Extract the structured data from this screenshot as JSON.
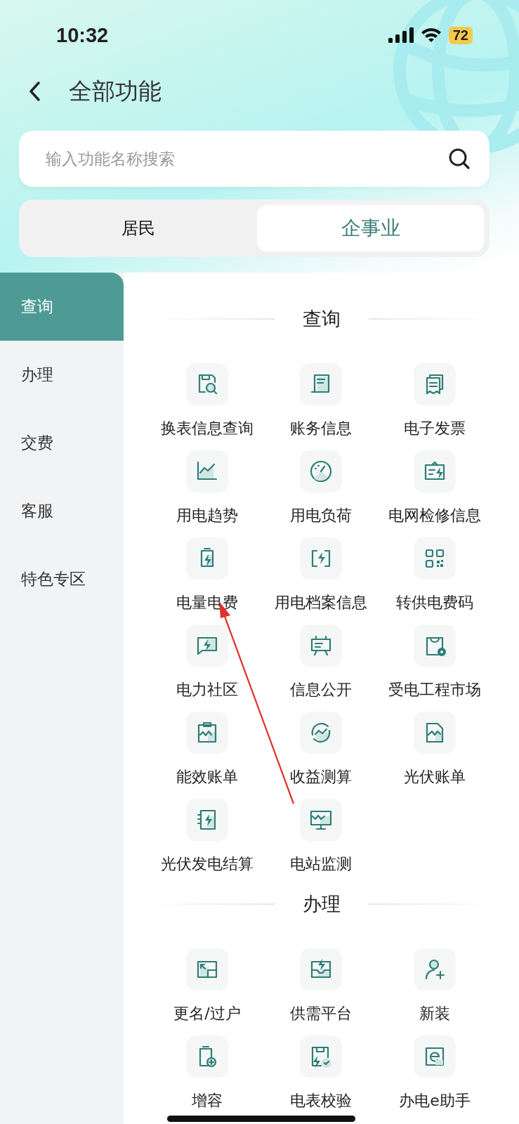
{
  "status_bar": {
    "time": "10:32",
    "battery": "72"
  },
  "header": {
    "title": "全部功能"
  },
  "search": {
    "placeholder": "输入功能名称搜索"
  },
  "tabs": [
    {
      "label": "居民",
      "selected": false
    },
    {
      "label": "企事业",
      "selected": true
    }
  ],
  "sidebar": {
    "items": [
      {
        "label": "查询",
        "selected": true
      },
      {
        "label": "办理",
        "selected": false
      },
      {
        "label": "交费",
        "selected": false
      },
      {
        "label": "客服",
        "selected": false
      },
      {
        "label": "特色专区",
        "selected": false
      }
    ]
  },
  "sections": [
    {
      "title": "查询",
      "items": [
        {
          "label": "换表信息查询",
          "kind": "floppy-search"
        },
        {
          "label": "账务信息",
          "kind": "scroll"
        },
        {
          "label": "电子发票",
          "kind": "receipt"
        },
        {
          "label": "用电趋势",
          "kind": "chart"
        },
        {
          "label": "用电负荷",
          "kind": "gauge"
        },
        {
          "label": "电网检修信息",
          "kind": "board-bolt"
        },
        {
          "label": "电量电费",
          "kind": "battery"
        },
        {
          "label": "用电档案信息",
          "kind": "frame-bolt"
        },
        {
          "label": "转供电费码",
          "kind": "qr"
        },
        {
          "label": "电力社区",
          "kind": "chat-bolt"
        },
        {
          "label": "信息公开",
          "kind": "easel"
        },
        {
          "label": "受电工程市场",
          "kind": "bag-gear"
        },
        {
          "label": "能效账单",
          "kind": "clipboard-wave"
        },
        {
          "label": "收益测算",
          "kind": "cycle-wave"
        },
        {
          "label": "光伏账单",
          "kind": "doc-wave"
        },
        {
          "label": "光伏发电结算",
          "kind": "notebook-bolt"
        },
        {
          "label": "电站监测",
          "kind": "monitor-wave"
        }
      ]
    },
    {
      "title": "办理",
      "items": [
        {
          "label": "更名/过户",
          "kind": "resize"
        },
        {
          "label": "供需平台",
          "kind": "tray-bolt"
        },
        {
          "label": "新装",
          "kind": "user-plus"
        },
        {
          "label": "增容",
          "kind": "battery-plus"
        },
        {
          "label": "电表校验",
          "kind": "floppy-check"
        },
        {
          "label": "办电e助手",
          "kind": "square-e"
        }
      ]
    }
  ]
}
